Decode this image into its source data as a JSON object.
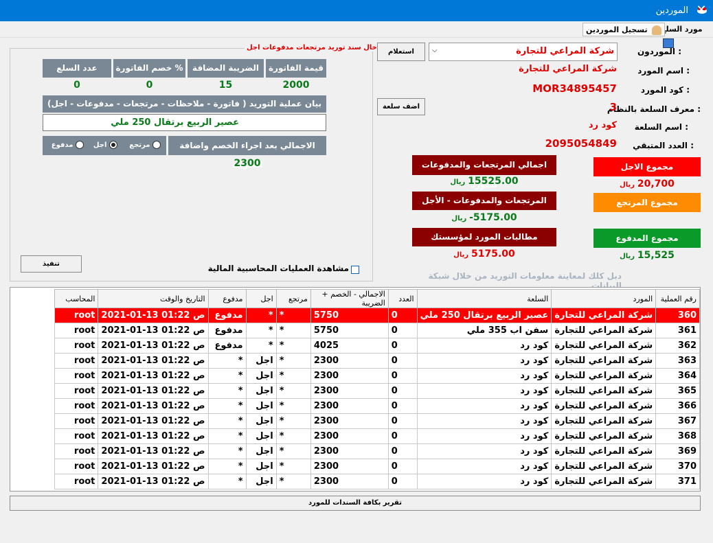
{
  "window": {
    "title": "الموردين",
    "close": "✕"
  },
  "toolbar": {
    "item1": "مورد السلع",
    "item2": "تسجيل الموردين"
  },
  "panel_note": "ادخال سند توريد مرتجعات مدفوعات اجل",
  "invoice": {
    "headers": [
      "قيمة الفاتورة",
      "الضريبة المضافة %",
      "خصم الفاتورة %",
      "عدد السلع"
    ],
    "values": [
      "2000",
      "15",
      "0",
      "0"
    ],
    "desc_header": "بيان عملية التوريد ( فاتورة - ملاحظات - مرتجعات - مدفوعات - اجل)",
    "desc_value": "عصير الربيع برتقال 250 ملي",
    "total_header": "الاجمالي بعد اجراء الخصم واضافة الضريبة",
    "total_value": "2300",
    "radio_returned": "مرتجع",
    "radio_deferred": "اجل",
    "radio_paid": "مدفوع",
    "execute": "تنفيذ",
    "view_ops": "مشاهدة العمليات المحاسبية المالية"
  },
  "supplier": {
    "label_suppliers": "الموردون :",
    "supplier_value": "شركة المراعي للتجارة",
    "inquiry": "استعلام",
    "label_name": "اسم المورد :",
    "name_value": "شركة المراعي للتجارة",
    "label_code": "كود المورد :",
    "code_value": "MOR34895457",
    "label_item_id": "معرف السلعة بالنظام :",
    "item_id_value": "3",
    "add_item": "اضف سلعة",
    "label_item_name": "اسم السلعة :",
    "item_name_value": "كود رد",
    "label_remaining": "العدد المتبقي :",
    "remaining_value": "2095054849"
  },
  "summary": {
    "total_returns_paid": "اجمالي المرتجعات والمدفوعات للمورد",
    "total_returns_paid_value": "15525.00",
    "currency": "ريال",
    "returns_minus_deferred": "المرتجعات والمدفوعات - الأجل",
    "returns_minus_deferred_value": "-5175.00",
    "supplier_claims": "مطالبات المورد لمؤسستك",
    "supplier_claims_value": "5175.00",
    "deferred_total": "مجموع الاجل",
    "deferred_total_value": "20,700",
    "returned_total": "مجموع المرتجع",
    "paid_total": "مجموع المدفوع",
    "paid_total_value": "15,525",
    "hint": "دبل كلك لمعاينة معلومات التوريد من خلال شبكة البيانات"
  },
  "grid": {
    "headers": [
      "رقم العملية",
      "المورد",
      "السلعة",
      "العدد",
      "الاجمالي - الخصم + الضريبة",
      "مرتجع",
      "اجل",
      "مدفوع",
      "التاريخ والوقت",
      "المحاسب"
    ],
    "rows": [
      [
        "360",
        "شركة المراعي للتجارة",
        "عصير الربيع برتقال 250 ملي",
        "0",
        "5750",
        "*",
        "*",
        "مدفوع",
        "2021-01-13 01:22 ص",
        "root"
      ],
      [
        "361",
        "شركة المراعي للتجارة",
        "سفن اب 355 ملي",
        "0",
        "5750",
        "*",
        "*",
        "مدفوع",
        "2021-01-13 01:22 ص",
        "root"
      ],
      [
        "362",
        "شركة المراعي للتجارة",
        "كود رد",
        "0",
        "4025",
        "*",
        "*",
        "مدفوع",
        "2021-01-13 01:22 ص",
        "root"
      ],
      [
        "363",
        "شركة المراعي للتجارة",
        "كود رد",
        "0",
        "2300",
        "*",
        "اجل",
        "*",
        "2021-01-13 01:22 ص",
        "root"
      ],
      [
        "364",
        "شركة المراعي للتجارة",
        "كود رد",
        "0",
        "2300",
        "*",
        "اجل",
        "*",
        "2021-01-13 01:22 ص",
        "root"
      ],
      [
        "365",
        "شركة المراعي للتجارة",
        "كود رد",
        "0",
        "2300",
        "*",
        "اجل",
        "*",
        "2021-01-13 01:22 ص",
        "root"
      ],
      [
        "366",
        "شركة المراعي للتجارة",
        "كود رد",
        "0",
        "2300",
        "*",
        "اجل",
        "*",
        "2021-01-13 01:22 ص",
        "root"
      ],
      [
        "367",
        "شركة المراعي للتجارة",
        "كود رد",
        "0",
        "2300",
        "*",
        "اجل",
        "*",
        "2021-01-13 01:22 ص",
        "root"
      ],
      [
        "368",
        "شركة المراعي للتجارة",
        "كود رد",
        "0",
        "2300",
        "*",
        "اجل",
        "*",
        "2021-01-13 01:22 ص",
        "root"
      ],
      [
        "369",
        "شركة المراعي للتجارة",
        "كود رد",
        "0",
        "2300",
        "*",
        "اجل",
        "*",
        "2021-01-13 01:22 ص",
        "root"
      ],
      [
        "370",
        "شركة المراعي للتجارة",
        "كود رد",
        "0",
        "2300",
        "*",
        "اجل",
        "*",
        "2021-01-13 01:22 ص",
        "root"
      ],
      [
        "371",
        "شركة المراعي للتجارة",
        "كود رد",
        "0",
        "2300",
        "*",
        "اجل",
        "*",
        "2021-01-13 01:22 ص",
        "root"
      ]
    ]
  },
  "report_button": "تقرير بكافة السندات للمورد",
  "colors": {
    "titlebar": "#0078d7",
    "dark_red": "#8b0000",
    "red": "#ff0000",
    "orange": "#ff8c00",
    "green": "#0a9a2a",
    "header_gray": "#7a8896"
  }
}
